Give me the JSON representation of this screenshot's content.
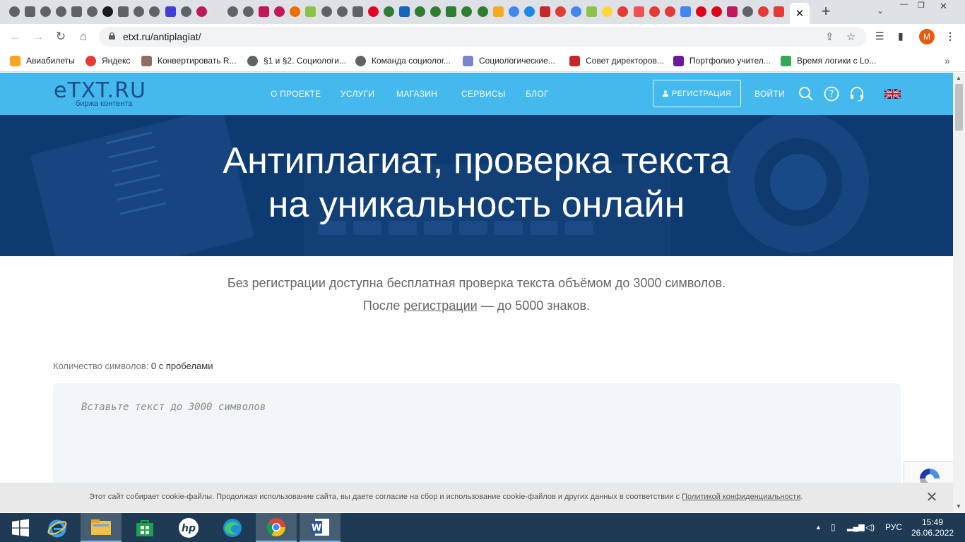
{
  "browser": {
    "active_tab_close": "✕",
    "new_tab": "+",
    "url": "etxt.ru/antiplagiat/",
    "profile_initial": "M",
    "window_controls": {
      "minimize": "—",
      "restore": "❐",
      "close": "✕"
    },
    "tab_search": "⌄",
    "colors": {
      "tabbar": "#dee1e6",
      "omnibox": "#f1f3f4",
      "profile": "#e8590c"
    }
  },
  "bookmarks": [
    {
      "label": "Авиабилеты",
      "icon": "plane-icon",
      "color": "#f5a623"
    },
    {
      "label": "Яндекс",
      "icon": "yandex-icon",
      "color": "#e53935"
    },
    {
      "label": "Конвертировать R...",
      "icon": "convert-icon",
      "color": "#8d6e63"
    },
    {
      "label": "§1 и §2. Социологи...",
      "icon": "globe-icon",
      "color": "#5f6368"
    },
    {
      "label": "Команда социолог...",
      "icon": "globe-icon",
      "color": "#5f6368"
    },
    {
      "label": "Социологические...",
      "icon": "chart-icon",
      "color": "#7986cb"
    },
    {
      "label": "Совет директоров...",
      "icon": "feather-icon",
      "color": "#c62828"
    },
    {
      "label": "Портфолио учител...",
      "icon": "portfolio-icon",
      "color": "#6a1b9a"
    },
    {
      "label": "Время логики с Lo...",
      "icon": "classroom-icon",
      "color": "#34a853"
    }
  ],
  "site": {
    "logo": "eTXT.RU",
    "logo_sub": "биржа контента",
    "menu": [
      "О ПРОЕКТЕ",
      "УСЛУГИ",
      "МАГАЗИН",
      "СЕРВИСЫ",
      "БЛОГ"
    ],
    "register": "РЕГИСТРАЦИЯ",
    "login": "ВОЙТИ",
    "colors": {
      "header": "#43b9ee",
      "hero": "#0e3a72",
      "logo": "#1f4d8a"
    }
  },
  "hero": {
    "line1": "Антиплагиат, проверка текста",
    "line2": "на уникальность онлайн"
  },
  "intro": {
    "line1": "Без регистрации доступна бесплатная проверка текста объёмом до 3000 символов.",
    "line2_before": "После ",
    "line2_link": "регистрации",
    "line2_after": " — до 5000 знаков."
  },
  "counter": {
    "label": "Количество символов: ",
    "value": "0 с пробелами"
  },
  "editor": {
    "placeholder": "Вставьте текст до 3000 символов"
  },
  "cookie": {
    "text": "Этот сайт собирает cookie-файлы. Продолжая использование сайта, вы даете согласие на сбор и использование cookie-файлов и других данных в соответствии с ",
    "link": "Политикой конфиденциальности",
    "after": ".",
    "close": "✕"
  },
  "taskbar": {
    "lang": "РУС",
    "time": "15:49",
    "date": "26.06.2022",
    "apps": [
      "windows-start-icon",
      "internet-explorer-icon",
      "file-explorer-icon",
      "microsoft-store-icon",
      "hp-icon",
      "edge-icon",
      "chrome-icon",
      "word-icon"
    ]
  }
}
